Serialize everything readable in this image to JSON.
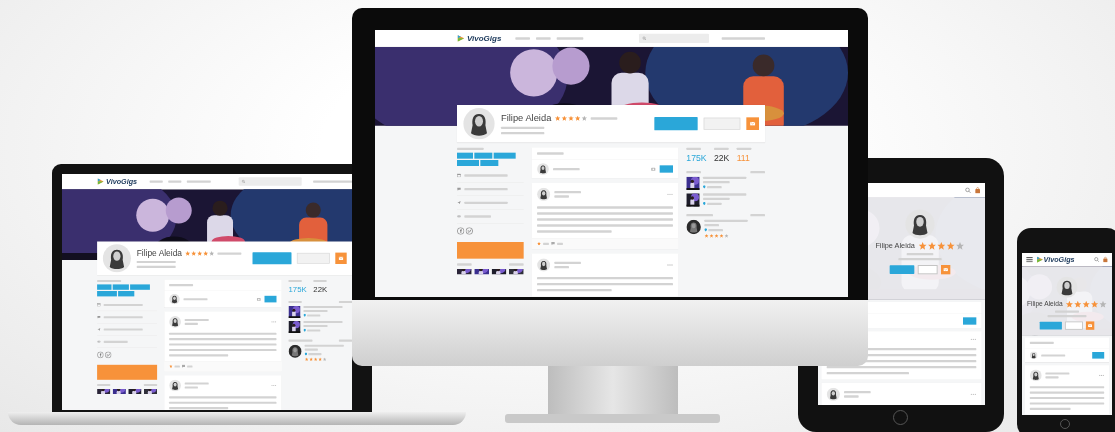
{
  "screens": [
    {
      "kind": "laptop",
      "logo": "VivoGigs",
      "profile": {
        "name": "Filipe Aleida",
        "stars": 4
      },
      "stats": [
        "175K",
        "22K"
      ],
      "review": {
        "stars": 4
      }
    },
    {
      "kind": "monitor",
      "logo": "VivoGigs",
      "profile": {
        "name": "Filipe Aleida",
        "stars": 4
      },
      "stats": [
        "175K",
        "22K",
        "111"
      ],
      "review": {
        "stars": 4
      }
    },
    {
      "kind": "tablet",
      "profile": {
        "name": "Filipe Aleida",
        "stars": 4
      }
    },
    {
      "kind": "phone",
      "logo": "VivoGigs",
      "profile": {
        "name": "Filipe Aleida",
        "stars": 4
      }
    }
  ]
}
